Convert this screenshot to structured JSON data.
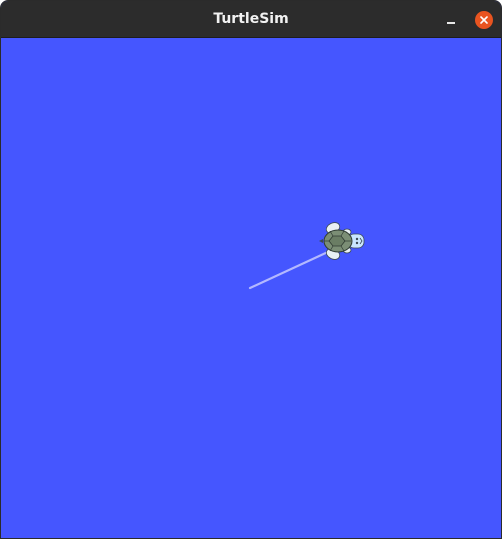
{
  "window": {
    "title": "TurtleSim"
  },
  "canvas": {
    "background_color": "#4556ff",
    "pen_color": "#b3b8ff"
  },
  "icons": {
    "minimize": "minimize-icon",
    "close": "close-icon",
    "turtle": "turtle-sprite"
  }
}
